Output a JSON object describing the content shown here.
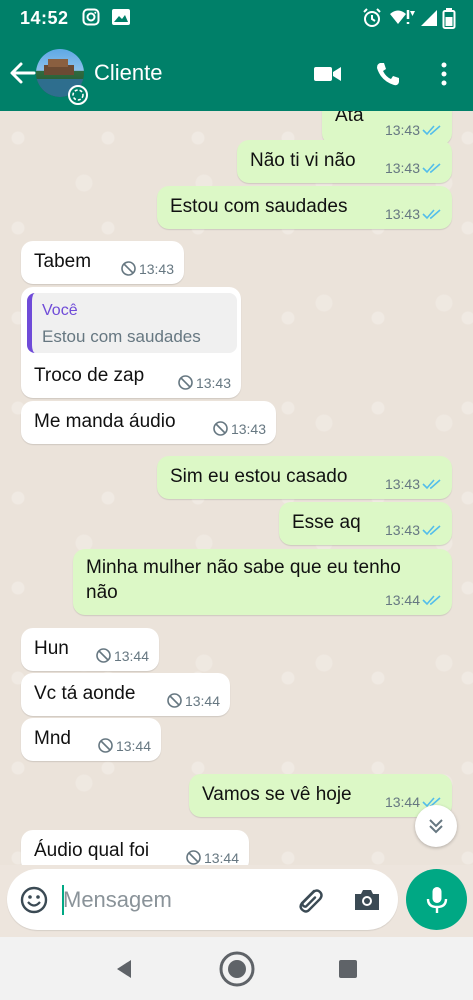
{
  "status_bar": {
    "time": "14:52",
    "left_icons": [
      "instagram-icon",
      "image-notification-icon"
    ],
    "right_icons": [
      "alarm-icon",
      "wifi-icon",
      "signal-icon",
      "battery-icon"
    ]
  },
  "header": {
    "contact_name": "Cliente",
    "icons": [
      "back-arrow-icon",
      "avatar",
      "video-call-icon",
      "voice-call-icon",
      "more-options-icon"
    ]
  },
  "messages": [
    {
      "dir": "out",
      "text": "Ata",
      "time": "13:43",
      "status": "read"
    },
    {
      "dir": "out",
      "text": "Não ti vi não",
      "time": "13:43",
      "status": "read"
    },
    {
      "dir": "out",
      "text": "Estou com saudades",
      "time": "13:43",
      "status": "read"
    },
    {
      "dir": "in",
      "text": "Tabem",
      "time": "13:43",
      "status": "deleted-icon"
    },
    {
      "dir": "in",
      "quote_author": "Você",
      "quote_text": "Estou com saudades",
      "text": "Troco de zap",
      "time": "13:43",
      "status": "deleted-icon"
    },
    {
      "dir": "in",
      "text": "Me manda áudio",
      "time": "13:43",
      "status": "deleted-icon"
    },
    {
      "dir": "out",
      "text": "Sim eu estou casado",
      "time": "13:43",
      "status": "read"
    },
    {
      "dir": "out",
      "text": "Esse aq",
      "time": "13:43",
      "status": "read"
    },
    {
      "dir": "out",
      "text_line1": "Minha mulher não sabe que eu tenho",
      "text_line2": "não",
      "time": "13:44",
      "status": "read"
    },
    {
      "dir": "in",
      "text": "Hun",
      "time": "13:44",
      "status": "deleted-icon"
    },
    {
      "dir": "in",
      "text": "Vc tá aonde",
      "time": "13:44",
      "status": "deleted-icon"
    },
    {
      "dir": "in",
      "text": "Mnd",
      "time": "13:44",
      "status": "deleted-icon"
    },
    {
      "dir": "out",
      "text": "Vamos se vê hoje",
      "time": "13:44",
      "status": "read"
    },
    {
      "dir": "in",
      "text": "Áudio qual foi",
      "time": "13:44",
      "status": "deleted-icon"
    }
  ],
  "composer": {
    "placeholder": "Mensagem",
    "value": "",
    "icons": [
      "emoji-icon",
      "attach-icon",
      "camera-icon",
      "mic-icon"
    ]
  },
  "colors": {
    "header": "#008069",
    "outgoing_bubble": "#dcf8c6",
    "incoming_bubble": "#ffffff",
    "read_tick": "#53bdeb",
    "mic_button": "#00a884",
    "quote_accent": "#6f4bd8"
  }
}
